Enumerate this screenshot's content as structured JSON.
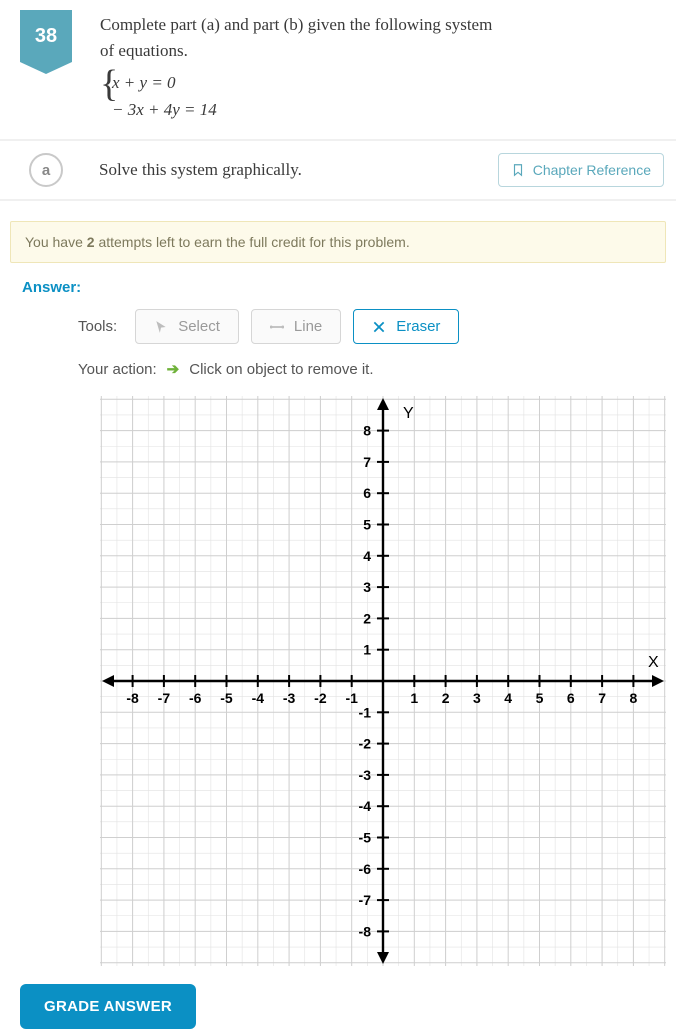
{
  "problem": {
    "number": "38",
    "prompt": "Complete part (a) and part (b) given the following system of equations.",
    "equations": [
      "x + y = 0",
      "− 3x + 4y = 14"
    ]
  },
  "part": {
    "letter": "a",
    "prompt": "Solve this system graphically.",
    "chapter_reference": "Chapter Reference"
  },
  "attempts": {
    "prefix": "You have ",
    "count": "2",
    "suffix": " attempts left to earn the full credit for this problem."
  },
  "answer": {
    "label": "Answer:",
    "tools_label": "Tools:",
    "tools": {
      "select": "Select",
      "line": "Line",
      "eraser": "Eraser"
    },
    "active_tool": "eraser",
    "action_label": "Your action:",
    "action_hint": "Click on object to remove it."
  },
  "chart_data": {
    "type": "scatter",
    "title": "",
    "xlabel": "X",
    "ylabel": "Y",
    "xlim": [
      -9,
      9
    ],
    "ylim": [
      -9,
      9
    ],
    "xticks": [
      -8,
      -7,
      -6,
      -5,
      -4,
      -3,
      -2,
      -1,
      1,
      2,
      3,
      4,
      5,
      6,
      7,
      8
    ],
    "yticks": [
      -8,
      -7,
      -6,
      -5,
      -4,
      -3,
      -2,
      -1,
      1,
      2,
      3,
      4,
      5,
      6,
      7,
      8
    ],
    "grid": true,
    "minor_grid": true,
    "series": []
  },
  "grade_button": "GRADE ANSWER"
}
